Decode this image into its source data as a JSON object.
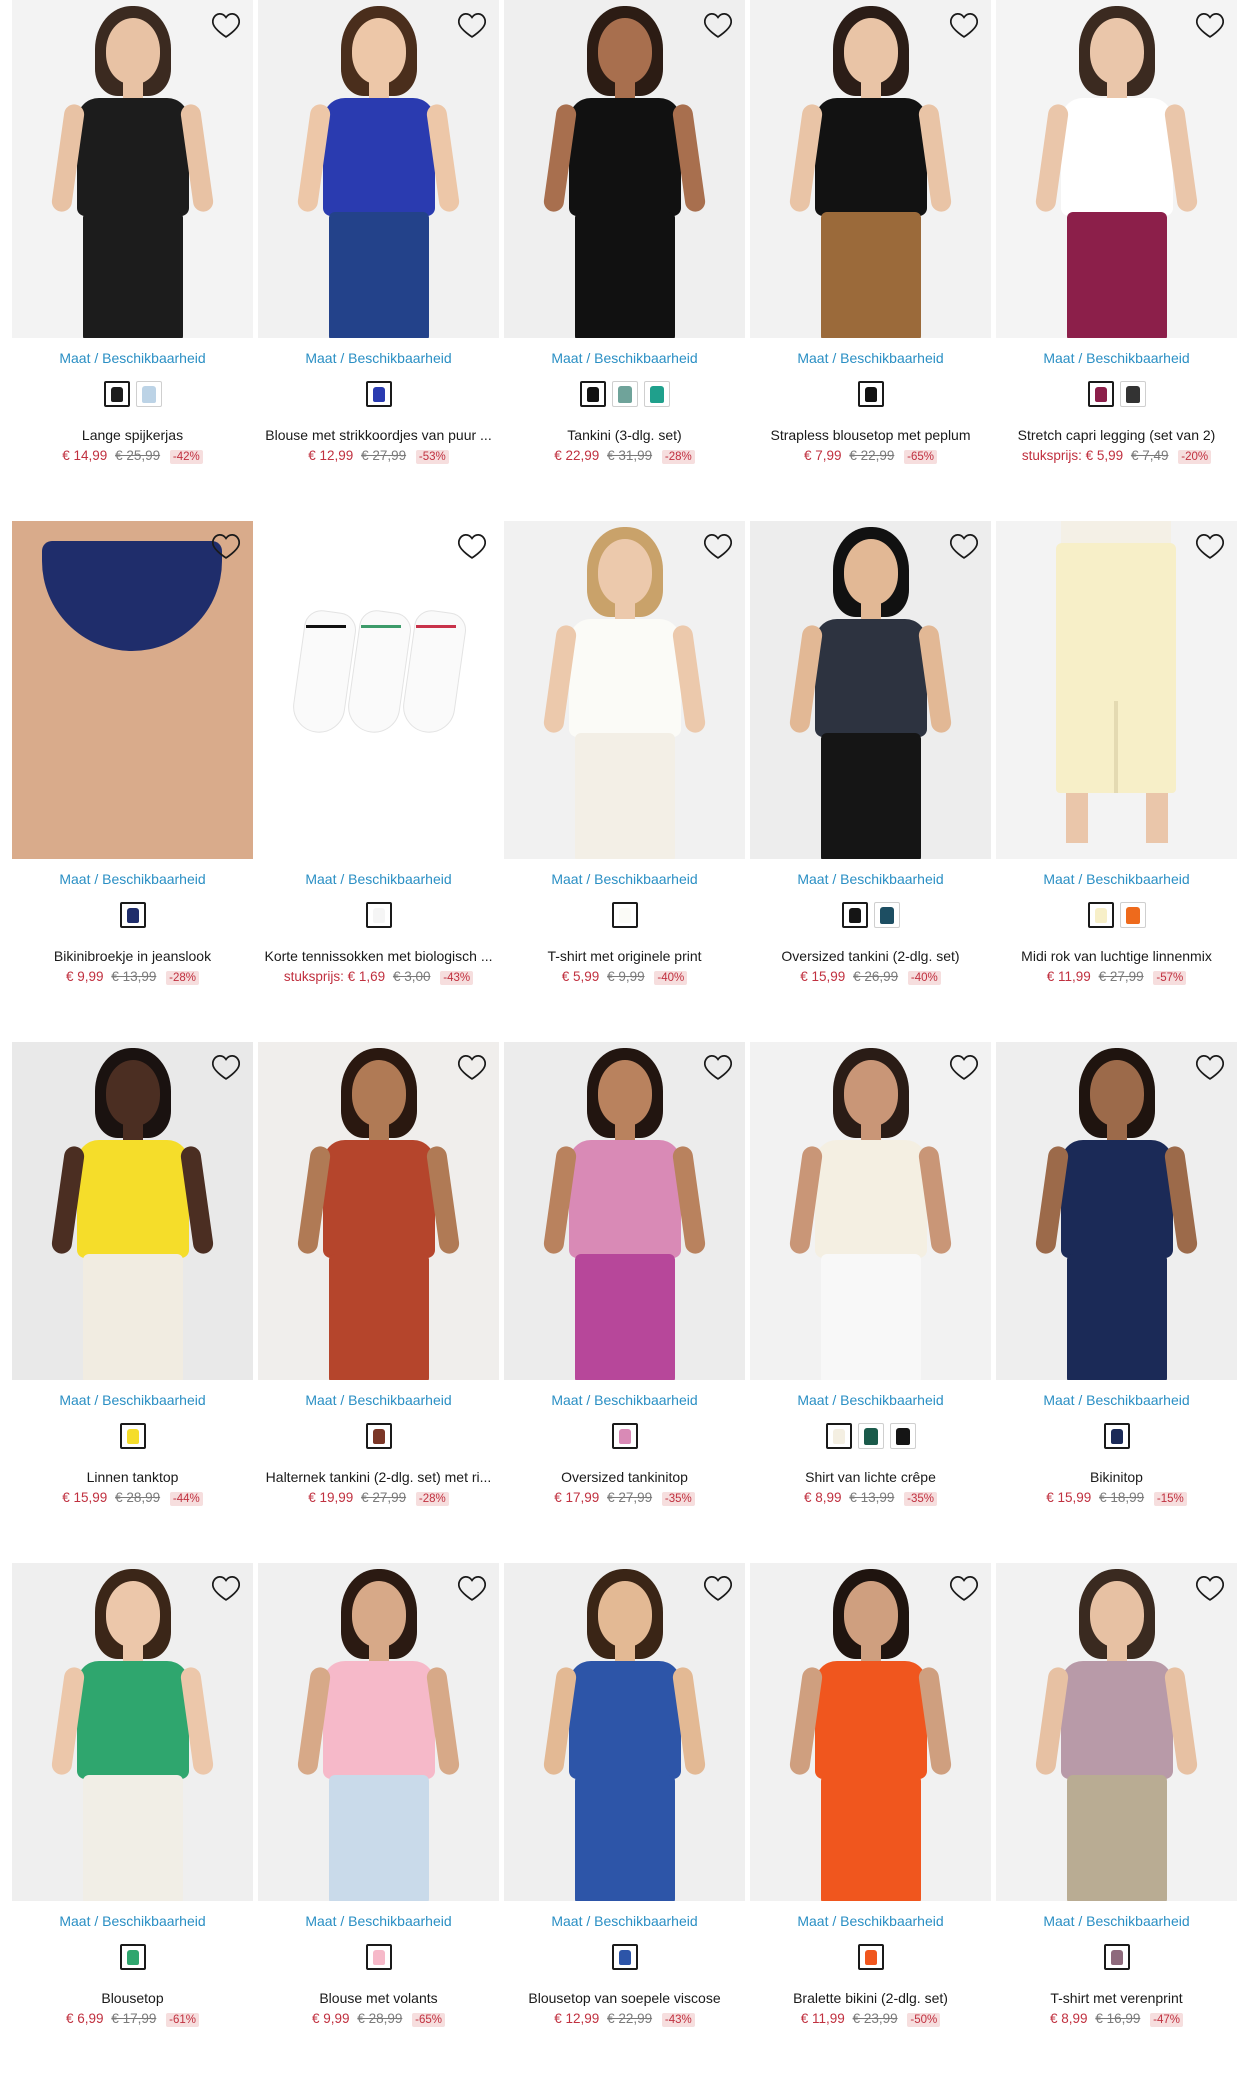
{
  "size_link_label": "Maat / Beschikbaarheid",
  "products": [
    {
      "name": "Lange spijkerjas",
      "price": "€ 14,99",
      "old_price": "€ 25,99",
      "discount": "-42%",
      "bg": "#f3f3f3",
      "top": "#1c1c1c",
      "bottom": "#1c1c1c",
      "skin": "#e8c2a4",
      "hair": "#3b2a20",
      "swatches": [
        "#1c1c1c",
        "#bcd3e6"
      ]
    },
    {
      "name": "Blouse met strikkoordjes van puur ...",
      "price": "€ 12,99",
      "old_price": "€ 27,99",
      "discount": "-53%",
      "bg": "#f1f1f1",
      "top": "#2a3bb0",
      "bottom": "#23428a",
      "skin": "#edc7a8",
      "hair": "#4a2e1c",
      "swatches": [
        "#2a3bb0"
      ]
    },
    {
      "name": "Tankini (3-dlg. set)",
      "price": "€ 22,99",
      "old_price": "€ 31,99",
      "discount": "-28%",
      "bg": "#efefef",
      "top": "#111111",
      "bottom": "#111111",
      "skin": "#a86f4e",
      "hair": "#2c1c14",
      "swatches": [
        "#111111",
        "#6fa39a",
        "#1fa08c"
      ]
    },
    {
      "name": "Strapless blousetop met peplum",
      "price": "€ 7,99",
      "old_price": "€ 22,99",
      "discount": "-65%",
      "bg": "#f2f2f2",
      "top": "#121212",
      "bottom": "#9b6a3a",
      "skin": "#e9c4a6",
      "hair": "#2b1d17",
      "swatches": [
        "#121212"
      ]
    },
    {
      "name": "Stretch capri legging (set van 2)",
      "price": "stuksprijs: € 5,99",
      "old_price": "€ 7,49",
      "discount": "-20%",
      "bg": "#f4f4f4",
      "top": "#ffffff",
      "bottom": "#8c1f4a",
      "skin": "#eac6aa",
      "hair": "#3b2a20",
      "swatches": [
        "#8c1f4a",
        "#333333"
      ]
    },
    {
      "name": "Bikinibroekje in jeanslook",
      "price": "€ 9,99",
      "old_price": "€ 13,99",
      "discount": "-28%",
      "bg": "#efece9",
      "top": "#d9ab8b",
      "bottom": "#1f2d6b",
      "skin": "#d9ab8b",
      "hair": "#d9ab8b",
      "swatches": [
        "#1f2d6b"
      ]
    },
    {
      "name": "Korte tennissokken met biologisch ...",
      "price": "stuksprijs: € 1,69",
      "old_price": "€ 3,00",
      "discount": "-43%",
      "bg": "#ffffff",
      "top": "#f2f2f2",
      "bottom": "#f2f2f2",
      "skin": "#ffffff",
      "hair": "#ffffff",
      "swatches": [
        "#f5f5f5"
      ]
    },
    {
      "name": "T-shirt met originele print",
      "price": "€ 5,99",
      "old_price": "€ 9,99",
      "discount": "-40%",
      "bg": "#f1f1f1",
      "top": "#fbfbf7",
      "bottom": "#f3efe6",
      "skin": "#ecc9ac",
      "hair": "#c9a26a",
      "swatches": [
        "#fbfbf7"
      ]
    },
    {
      "name": "Oversized tankini (2-dlg. set)",
      "price": "€ 15,99",
      "old_price": "€ 26,99",
      "discount": "-40%",
      "bg": "#ededed",
      "top": "#2d3340",
      "bottom": "#151515",
      "skin": "#e2b895",
      "hair": "#111111",
      "swatches": [
        "#151515",
        "#1d4e62"
      ]
    },
    {
      "name": "Midi rok van luchtige linnenmix",
      "price": "€ 11,99",
      "old_price": "€ 27,99",
      "discount": "-57%",
      "bg": "#f3f3f3",
      "top": "#f4f0e6",
      "bottom": "#f7efc8",
      "skin": "#eac6aa",
      "hair": "#eac6aa",
      "swatches": [
        "#f7efc8",
        "#ee6a1c"
      ]
    },
    {
      "name": "Linnen tanktop",
      "price": "€ 15,99",
      "old_price": "€ 28,99",
      "discount": "-44%",
      "bg": "#e9e9e9",
      "top": "#f5dd2a",
      "bottom": "#f1ece1",
      "skin": "#4b2e22",
      "hair": "#1a1210",
      "swatches": [
        "#f5dd2a"
      ]
    },
    {
      "name": "Halternek tankini (2-dlg. set) met ri...",
      "price": "€ 19,99",
      "old_price": "€ 27,99",
      "discount": "-28%",
      "bg": "#f0eeec",
      "top": "#b5452c",
      "bottom": "#b5452c",
      "skin": "#b07a55",
      "hair": "#2a1810",
      "swatches": [
        "#7b3626"
      ]
    },
    {
      "name": "Oversized tankinitop",
      "price": "€ 17,99",
      "old_price": "€ 27,99",
      "discount": "-35%",
      "bg": "#ececec",
      "top": "#d98ab6",
      "bottom": "#b7479a",
      "skin": "#b9825e",
      "hair": "#221510",
      "swatches": [
        "#d98ab6"
      ]
    },
    {
      "name": "Shirt van lichte crêpe",
      "price": "€ 8,99",
      "old_price": "€ 13,99",
      "discount": "-35%",
      "bg": "#f2f2f2",
      "top": "#f4efe2",
      "bottom": "#f8f8f8",
      "skin": "#c99677",
      "hair": "#2a1c16",
      "swatches": [
        "#f4efe2",
        "#1a5a4a",
        "#151515"
      ]
    },
    {
      "name": "Bikinitop",
      "price": "€ 15,99",
      "old_price": "€ 18,99",
      "discount": "-15%",
      "bg": "#eeeeee",
      "top": "#1b2a57",
      "bottom": "#1b2a57",
      "skin": "#9c6a4a",
      "hair": "#1f140f",
      "swatches": [
        "#1b2a57"
      ]
    },
    {
      "name": "Blousetop",
      "price": "€ 6,99",
      "old_price": "€ 17,99",
      "discount": "-61%",
      "bg": "#efefef",
      "top": "#2fa66e",
      "bottom": "#f1eee6",
      "skin": "#ecc7aa",
      "hair": "#3b2618",
      "swatches": [
        "#2fa66e"
      ]
    },
    {
      "name": "Blouse met volants",
      "price": "€ 9,99",
      "old_price": "€ 28,99",
      "discount": "-65%",
      "bg": "#f0f0f0",
      "top": "#f6b9c9",
      "bottom": "#c9daea",
      "skin": "#d7a988",
      "hair": "#2b1a12",
      "swatches": [
        "#f6b9c9"
      ]
    },
    {
      "name": "Blousetop van soepele viscose",
      "price": "€ 12,99",
      "old_price": "€ 22,99",
      "discount": "-43%",
      "bg": "#efefef",
      "top": "#2d55a8",
      "bottom": "#2d55a8",
      "skin": "#e3b994",
      "hair": "#3a2516",
      "swatches": [
        "#2d55a8"
      ]
    },
    {
      "name": "Bralette bikini (2-dlg. set)",
      "price": "€ 11,99",
      "old_price": "€ 23,99",
      "discount": "-50%",
      "bg": "#f1f1f1",
      "top": "#f0561e",
      "bottom": "#f0561e",
      "skin": "#cf9f7f",
      "hair": "#1f140f",
      "swatches": [
        "#f0561e"
      ]
    },
    {
      "name": "T-shirt met verenprint",
      "price": "€ 8,99",
      "old_price": "€ 16,99",
      "discount": "-47%",
      "bg": "#f2f2f2",
      "top": "#b89aa8",
      "bottom": "#b9ac93",
      "skin": "#e7c1a3",
      "hair": "#3a2a20",
      "swatches": [
        "#8e6a7c"
      ]
    }
  ]
}
